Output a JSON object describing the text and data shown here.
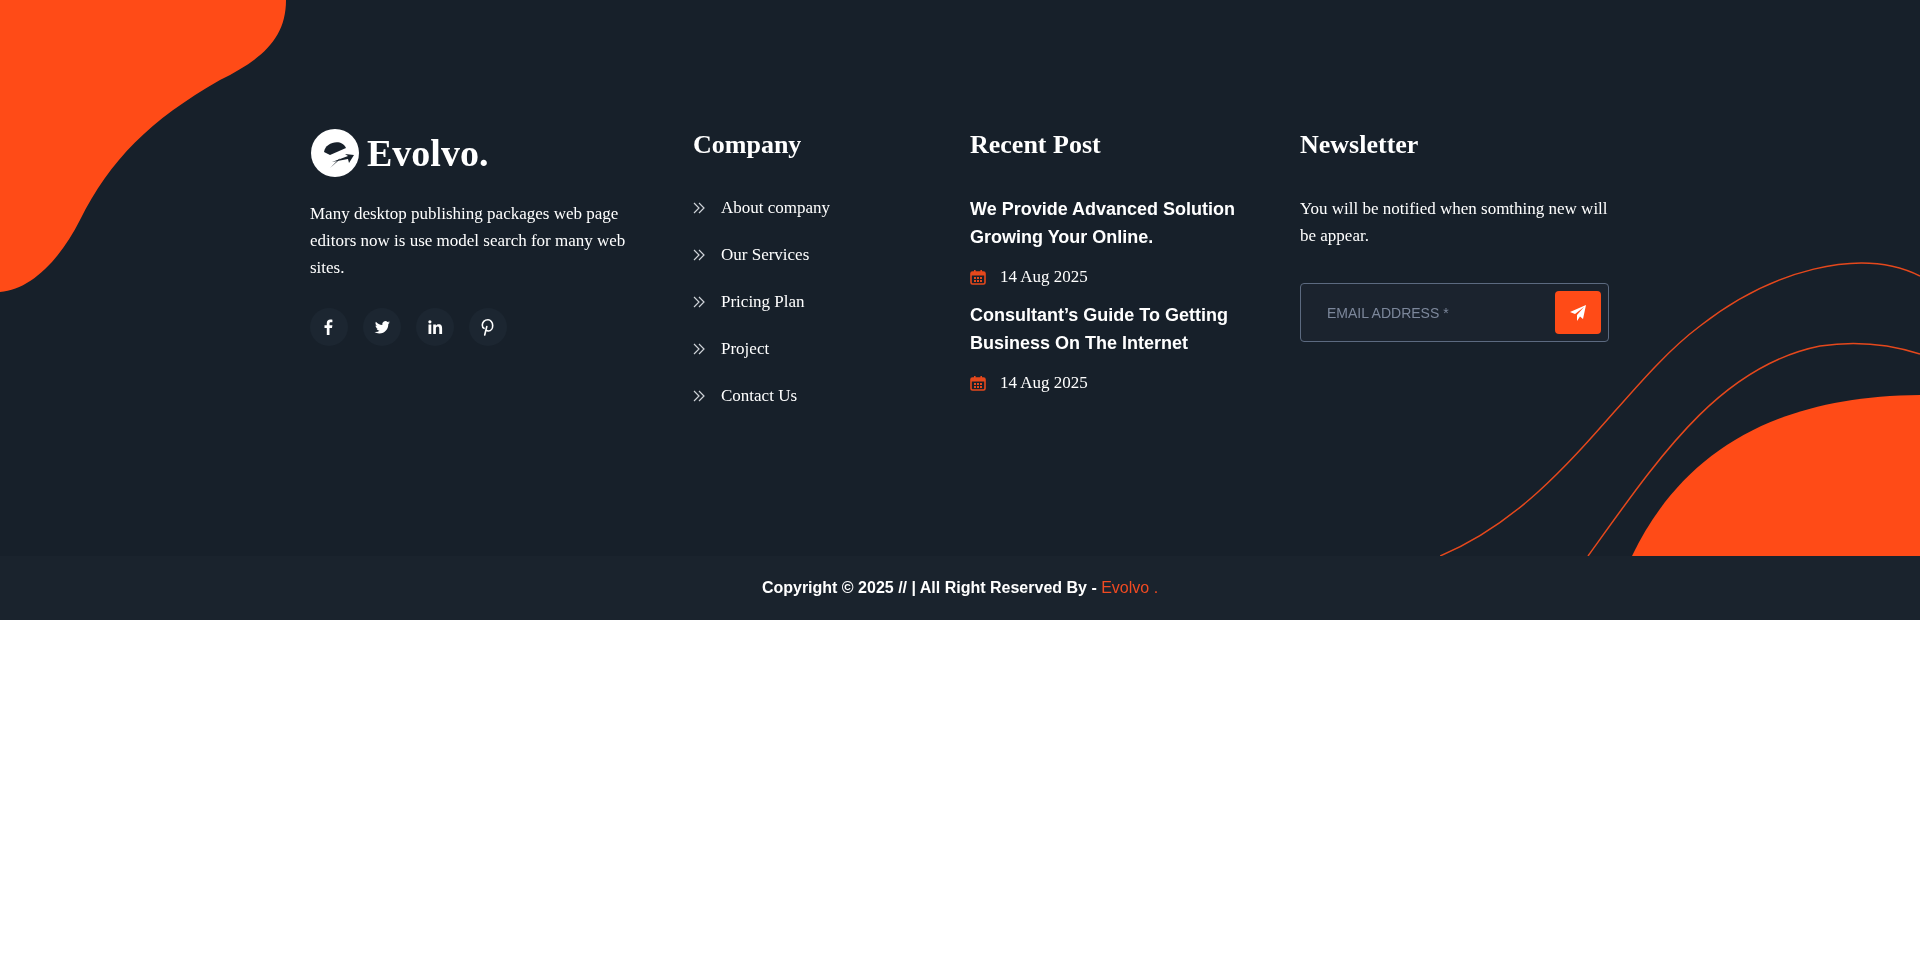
{
  "brand": {
    "name": "Evolvo.",
    "description": "Many desktop publishing packages web page editors now is use model search for many web sites.",
    "socials": [
      {
        "kind": "facebook"
      },
      {
        "kind": "twitter"
      },
      {
        "kind": "linkedin"
      },
      {
        "kind": "pinterest"
      }
    ]
  },
  "company": {
    "heading": "Company",
    "links": [
      "About company",
      "Our Services",
      "Pricing Plan",
      "Project",
      "Contact Us"
    ]
  },
  "recent_posts": {
    "heading": "Recent Post",
    "posts": [
      {
        "title": "We Provide Advanced Solution Growing Your Online.",
        "date": "14 Aug 2025"
      },
      {
        "title": "Consultant’s Guide To Getting Business On The Internet",
        "date": "14 Aug 2025"
      }
    ]
  },
  "newsletter": {
    "heading": "Newsletter",
    "text": "You will be notified when somthing new will be appear.",
    "placeholder": "EMAIL ADDRESS *"
  },
  "bottom_bar": {
    "copyright": "Copyright © 2025 // | All Right Reserved By - ",
    "link": "Evolvo ."
  }
}
